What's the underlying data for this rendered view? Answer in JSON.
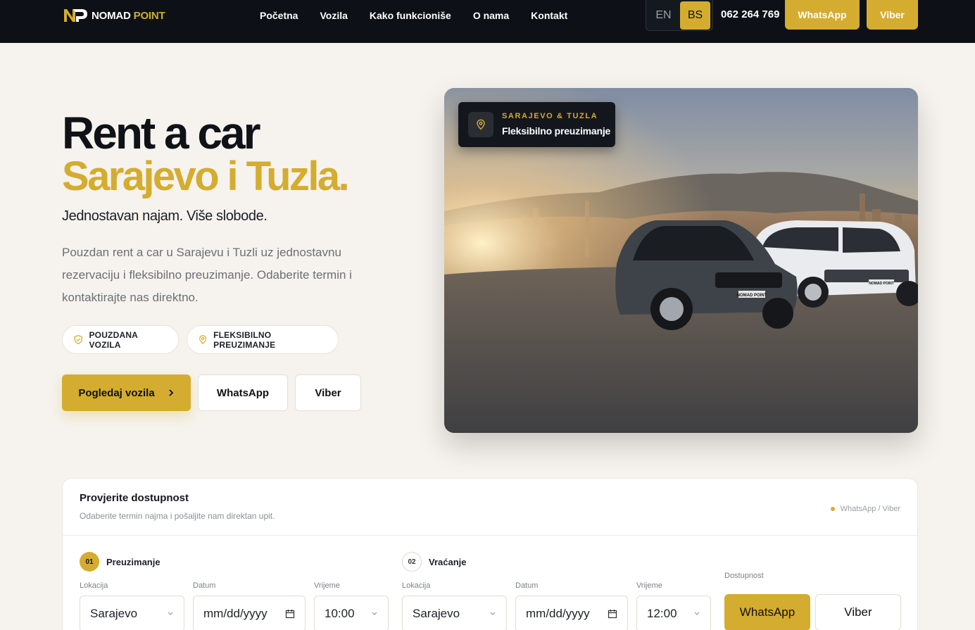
{
  "header": {
    "logo_text_1": "NOMAD",
    "logo_text_2": "POINT",
    "nav": [
      "Početna",
      "Vozila",
      "Kako funkcioniše",
      "O nama",
      "Kontakt"
    ],
    "lang_en": "EN",
    "lang_bs": "BS",
    "phone": "062 264 769",
    "whatsapp": "WhatsApp",
    "viber": "Viber"
  },
  "hero": {
    "title_line1": "Rent a car",
    "title_line2": "Sarajevo i Tuzla.",
    "tagline": "Jednostavan najam. Više slobode.",
    "lead": "Pouzdan rent a car u Sarajevu i Tuzli uz jednostavnu rezervaciju i fleksibilno preuzimanje. Odaberite termin i kontaktirajte nas direktno.",
    "pill_1": "POUZDANA VOZILA",
    "pill_2": "FLEKSIBILNO PREUZIMANJE",
    "btn_primary": "Pogledaj vozila",
    "btn_whatsapp": "WhatsApp",
    "btn_viber": "Viber",
    "badge_kicker": "SARAJEVO & TUZLA",
    "badge_text": "Fleksibilno preuzimanje",
    "car_plate_1": "NOMAD POINT",
    "car_plate_2": "NOMAD POINT"
  },
  "availability": {
    "title": "Provjerite dostupnost",
    "subtitle": "Odaberite termin najma i pošaljite nam direktan upit.",
    "note": "WhatsApp / Viber",
    "pickup": {
      "num": "01",
      "label": "Preuzimanje",
      "location_label": "Lokacija",
      "location": "Sarajevo",
      "date_label": "Datum",
      "date": "mm/dd/yyyy",
      "time_label": "Vrijeme",
      "time": "10:00"
    },
    "return": {
      "num": "02",
      "label": "Vraćanje",
      "location_label": "Lokacija",
      "location": "Sarajevo",
      "date_label": "Datum",
      "date": "mm/dd/yyyy",
      "time_label": "Vrijeme",
      "time": "12:00"
    },
    "availability_label": "Dostupnost",
    "whatsapp": "WhatsApp",
    "viber": "Viber"
  },
  "colors": {
    "accent": "#d4ac2f",
    "dark": "#0d1117",
    "background": "#f6f3ee"
  }
}
